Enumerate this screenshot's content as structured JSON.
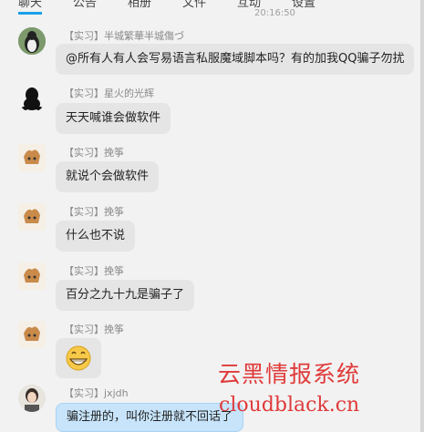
{
  "top_tabs": [
    "聊天",
    "公告",
    "相册",
    "文件",
    "互动",
    "设置"
  ],
  "timestamp": "20:16:50",
  "messages": [
    {
      "tag": "【实习】",
      "sender": "半城繁華半城傷づ",
      "text": "@所有人有人会写易语言私服魔域脚本吗？有的加我QQ骗子勿扰"
    },
    {
      "tag": "【实习】",
      "sender": "星火的光辉",
      "text": "天天喊谁会做软件"
    },
    {
      "tag": "【实习】",
      "sender": "挽筝",
      "text": "就说个会做软件"
    },
    {
      "tag": "【实习】",
      "sender": "挽筝",
      "text": "什么也不说"
    },
    {
      "tag": "【实习】",
      "sender": "挽筝",
      "text": "百分之九十九是骗子了"
    },
    {
      "tag": "【实习】",
      "sender": "挽筝",
      "text": ""
    },
    {
      "tag": "【实习】",
      "sender": "jxjdh",
      "text": "骗注册的，叫你注册就不回话了"
    }
  ],
  "watermark": {
    "cn": "云黑情报系统",
    "en": "cloudblack.cn"
  },
  "colors": {
    "accent": "#1aa0e8",
    "watermark": "#e03a3a",
    "bubble": "#e5e5e5",
    "bubble_self": "#c7e4fb"
  }
}
